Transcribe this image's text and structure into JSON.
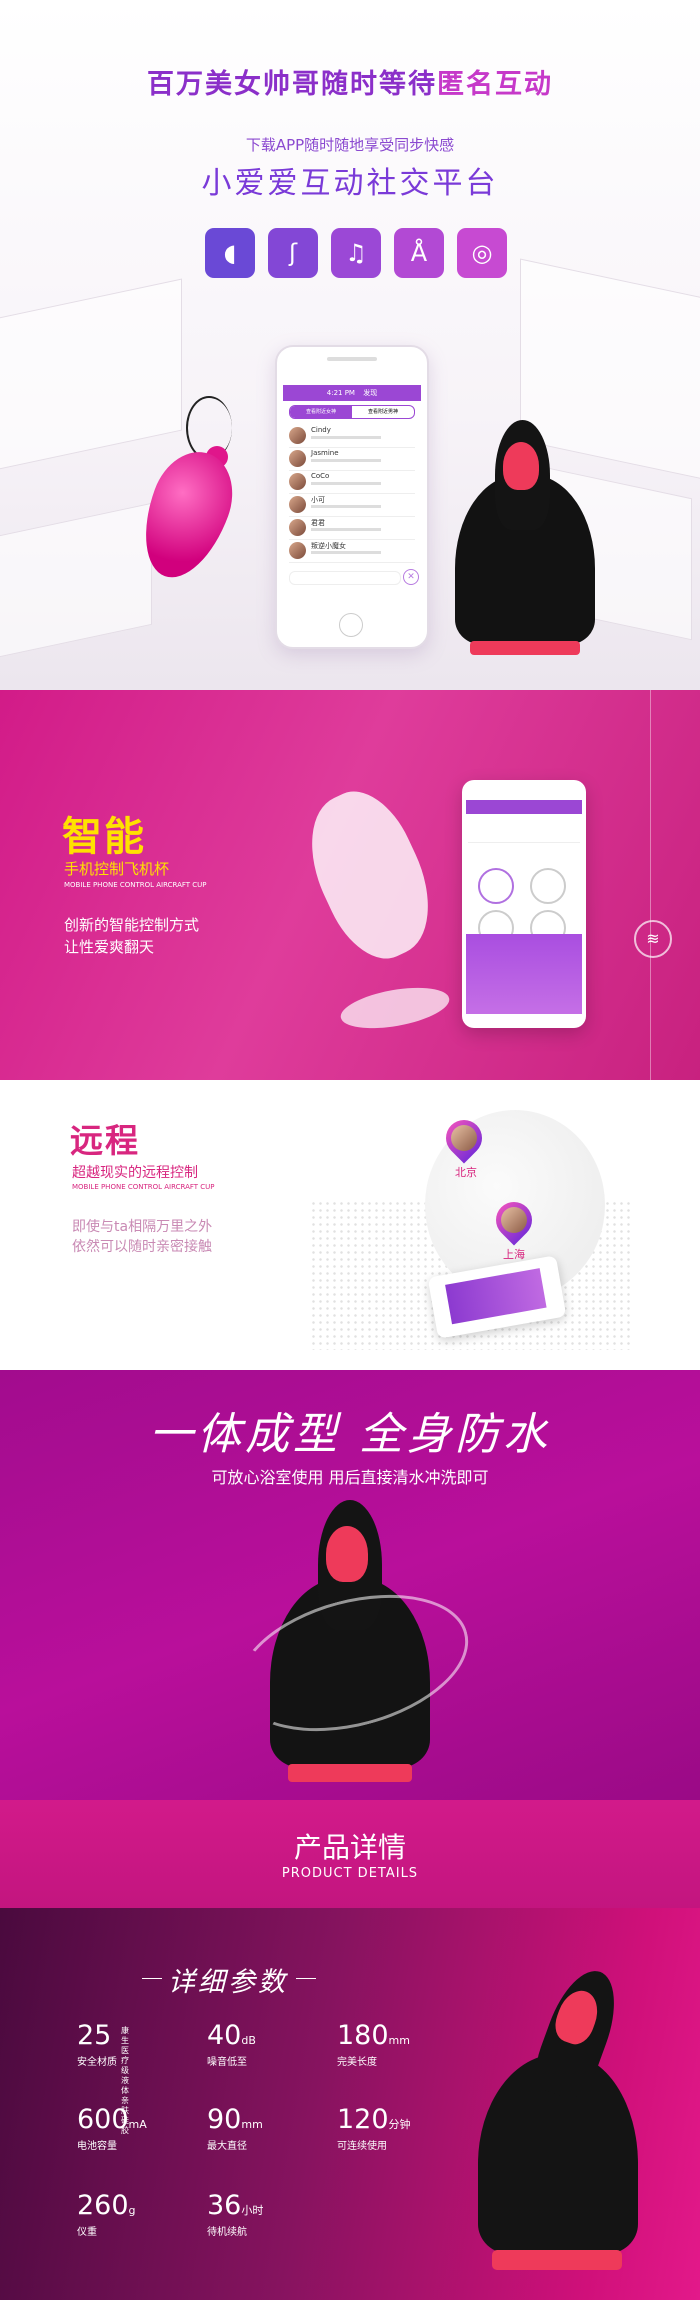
{
  "hero": {
    "title_main": "百万美女帅哥随时等待",
    "title_highlight": "匿名互动",
    "subtitle": "下载APP随时随地享受同步快感",
    "platform": "小爱爱互动社交平台",
    "feature_icons": [
      {
        "name": "egg-vibrator-icon",
        "glyph": "◖",
        "color": "#6a49d6"
      },
      {
        "name": "body-touch-icon",
        "glyph": "ʃ",
        "color": "#8347d6"
      },
      {
        "name": "music-note-icon",
        "glyph": "♫",
        "color": "#9b48d6"
      },
      {
        "name": "dancer-icon",
        "glyph": "Å",
        "color": "#b249d4"
      },
      {
        "name": "wireless-icon",
        "glyph": "◎",
        "color": "#c74ad2"
      }
    ],
    "phone": {
      "status": "4:21 PM",
      "title": "发现",
      "tabs": [
        "查看附近女神",
        "查看附近男神"
      ],
      "contacts": [
        "Cindy",
        "Jasmine",
        "CoCo",
        "小可",
        "君君",
        "叛逆小魔女"
      ]
    }
  },
  "smart": {
    "title": "智能",
    "subtitle": "手机控制飞机杯",
    "subtitle_en": "MOBILE PHONE CONTROL AIRCRAFT CUP",
    "desc_1": "创新的智能控制方式",
    "desc_2": "让性爱爽翻天"
  },
  "remote": {
    "title": "远程",
    "subtitle": "超越现实的远程控制",
    "subtitle_en": "MOBILE PHONE CONTROL AIRCRAFT CUP",
    "desc_1": "即使与ta相隔万里之外",
    "desc_2": "依然可以随时亲密接触",
    "city_1": "北京",
    "city_2": "上海"
  },
  "water": {
    "title": "一体成型  全身防水",
    "subtitle": "可放心浴室使用  用后直接清水冲洗即可"
  },
  "details": {
    "title_cn": "产品详情",
    "title_en": "PRODUCT DETAILS"
  },
  "params": {
    "title": "详细参数",
    "items": [
      {
        "value": "25",
        "unit": "",
        "label": "安全材质",
        "note_1": "康生医疗",
        "note_2": "级液体亲肤硅胶"
      },
      {
        "value": "40",
        "unit": "dB",
        "label": "噪音低至",
        "note_1": "",
        "note_2": ""
      },
      {
        "value": "180",
        "unit": "mm",
        "label": "完美长度",
        "note_1": "",
        "note_2": ""
      },
      {
        "value": "600",
        "unit": "mA",
        "label": "电池容量",
        "note_1": "",
        "note_2": ""
      },
      {
        "value": "90",
        "unit": "mm",
        "label": "最大直径",
        "note_1": "",
        "note_2": ""
      },
      {
        "value": "120",
        "unit": "分钟",
        "label": "可连续使用",
        "note_1": "",
        "note_2": ""
      },
      {
        "value": "260",
        "unit": "g",
        "label": "仪重",
        "note_1": "",
        "note_2": ""
      },
      {
        "value": "36",
        "unit": "小时",
        "label": "待机续航",
        "note_1": "",
        "note_2": ""
      }
    ]
  }
}
